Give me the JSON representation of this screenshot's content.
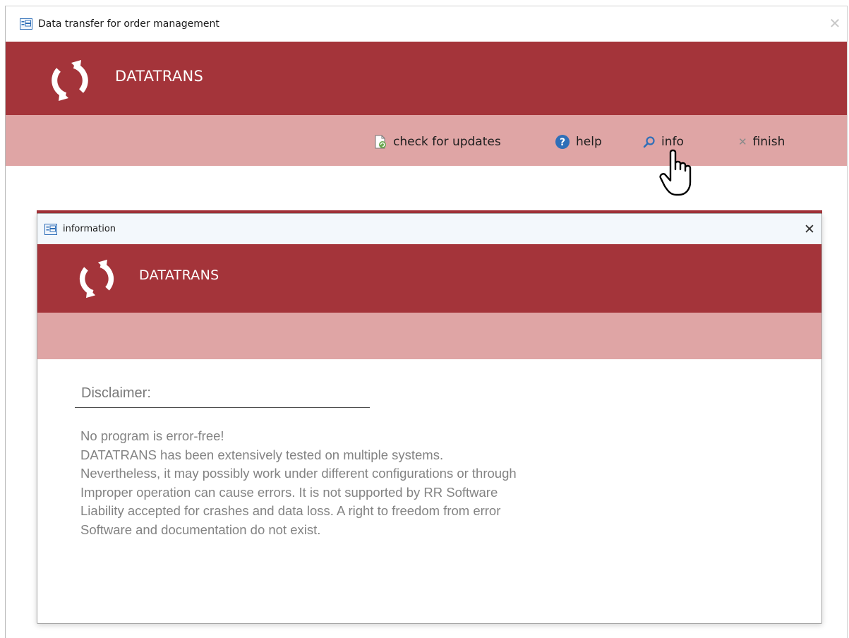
{
  "main_window": {
    "title": "Data transfer for order management",
    "close_glyph": "✕",
    "banner": {
      "logo_text": "DATATRANS"
    },
    "toolbar": {
      "items": [
        {
          "label": "check for updates",
          "icon": "update-document-icon"
        },
        {
          "label": "help",
          "icon": "help-circle-icon"
        },
        {
          "label": "info",
          "icon": "magnifier-icon"
        },
        {
          "label": "finish",
          "icon": "x-icon"
        }
      ]
    }
  },
  "dialog": {
    "title": "information",
    "close_glyph": "✕",
    "banner": {
      "logo_text": "DATATRANS"
    },
    "disclaimer": {
      "heading": "Disclaimer:",
      "lines": [
        "No program is error-free!",
        "DATATRANS has been extensively tested on multiple systems.",
        "Nevertheless, it may possibly work under different configurations or through",
        "Improper operation can cause errors. It is not supported by RR Software",
        "Liability accepted for crashes and data loss. A right to freedom from error",
        "Software and documentation do not exist."
      ]
    }
  },
  "colors": {
    "banner": "#a4343a",
    "toolbar": "#dfa5a5",
    "disclaimer_text": "#838383"
  }
}
